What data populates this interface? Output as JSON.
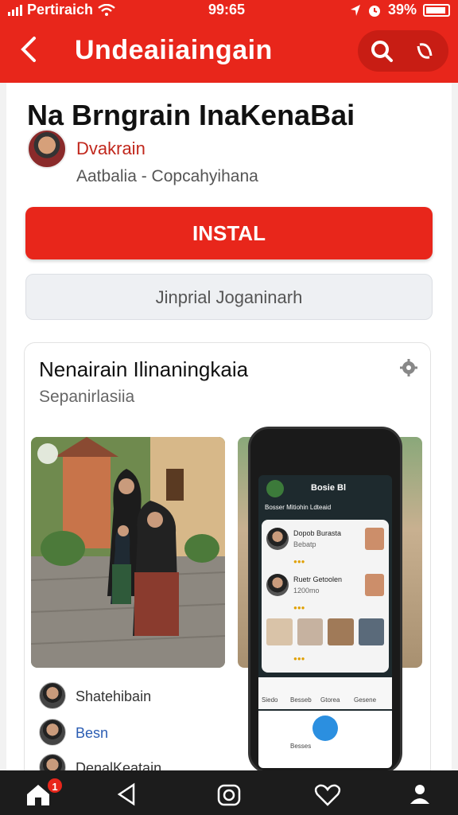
{
  "status_bar": {
    "carrier": "Pertiraich",
    "time": "99:65",
    "battery": "39%"
  },
  "header": {
    "title": "Undeaiiaingain"
  },
  "app": {
    "title": "Na Brngrain InaKenaBai",
    "developer": "Dvakrain",
    "meta": "Aatbalia - Copcahyihana"
  },
  "actions": {
    "install_label": "INSTAL",
    "secondary_label": "Jinprial Joganinarh"
  },
  "preview_card": {
    "title": "Nenairain Ilinaningkaia",
    "subtitle": "Sepanirlasiia"
  },
  "contacts": [
    {
      "name": "Shatehibain"
    },
    {
      "name": "Besn"
    },
    {
      "name": "DenalKeatain"
    }
  ],
  "phone_mock": {
    "top_label": "Bosie Bl",
    "subheader": "Bosser Mitiohin Ldteaid",
    "items": [
      {
        "line1": "Dopob Burasta",
        "line2": "Bebatp"
      },
      {
        "line1": "Ruetr Getoolen",
        "line2": "1200mo"
      }
    ],
    "nav_labels": [
      "Siedo",
      "Besseb",
      "Gtorea",
      "Gesene"
    ],
    "bottom_label": "Besses"
  },
  "bottom_nav": {
    "badge_count": "1"
  },
  "colors": {
    "brand": "#e8261b",
    "link": "#2b5db3"
  }
}
